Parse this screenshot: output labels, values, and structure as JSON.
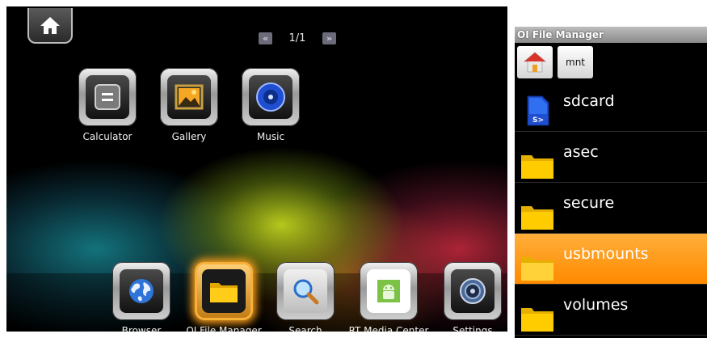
{
  "launcher": {
    "pager": {
      "prev_icon": "double-chevron-left-icon",
      "text": "1/1",
      "next_icon": "double-chevron-right-icon"
    },
    "apps": [
      {
        "label": "Calculator",
        "icon": "calculator-icon"
      },
      {
        "label": "Gallery",
        "icon": "gallery-icon"
      },
      {
        "label": "Music",
        "icon": "music-icon"
      }
    ],
    "dock": [
      {
        "label": "Browser",
        "icon": "globe-icon"
      },
      {
        "label": "OI File Manager",
        "icon": "folder-icon"
      },
      {
        "label": "Search",
        "icon": "magnifier-icon"
      },
      {
        "label": "RT Media Center",
        "icon": "android-icon"
      },
      {
        "label": "Settings",
        "icon": "settings-icon"
      }
    ]
  },
  "file_manager": {
    "title": "OI File Manager",
    "breadcrumb": {
      "home_icon": "home-icon",
      "current": "mnt"
    },
    "items": [
      {
        "name": "sdcard",
        "icon": "sdcard-icon"
      },
      {
        "name": "asec",
        "icon": "folder-icon"
      },
      {
        "name": "secure",
        "icon": "folder-icon"
      },
      {
        "name": "usbmounts",
        "icon": "folder-icon",
        "selected": true
      },
      {
        "name": "volumes",
        "icon": "folder-icon"
      }
    ],
    "colors": {
      "selection": "#ff9a10",
      "folder": "#ffcc00"
    }
  }
}
